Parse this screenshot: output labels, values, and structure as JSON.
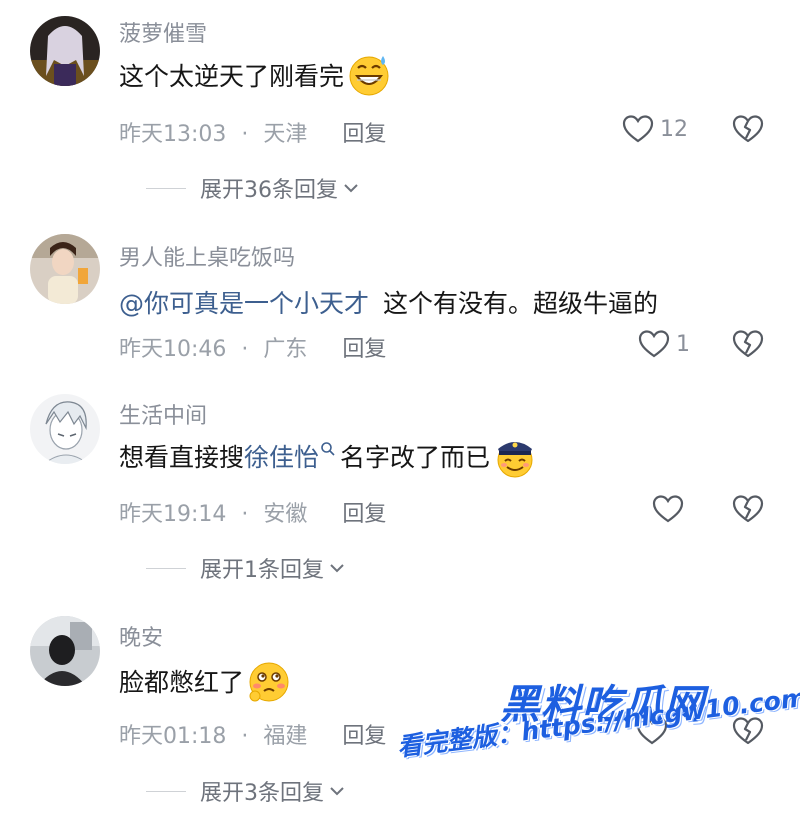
{
  "comments": [
    {
      "username": "菠萝催雪",
      "text": "这个太逆天了刚看完",
      "time": "昨天13:03",
      "location": "天津",
      "reply_label": "回复",
      "likes": "12",
      "expand": "展开36条回复"
    },
    {
      "username": "男人能上桌吃饭吗",
      "mention": "@你可真是一个小天才",
      "text": "这个有没有。超级牛逼的",
      "time": "昨天10:46",
      "location": "广东",
      "reply_label": "回复",
      "likes": "1"
    },
    {
      "username": "生活中间",
      "text_before": "想看直接搜",
      "search_link": "徐佳怡",
      "text_after": "名字改了而已",
      "time": "昨天19:14",
      "location": "安徽",
      "reply_label": "回复",
      "likes": "",
      "expand": "展开1条回复"
    },
    {
      "username": "晚安",
      "text": "脸都憋红了",
      "time": "昨天01:18",
      "location": "福建",
      "reply_label": "回复",
      "expand": "展开3条回复"
    }
  ],
  "separator": "·",
  "watermark": {
    "title": "黑料吃瓜网",
    "line": "看完整版：https://hlcgw10.com"
  }
}
